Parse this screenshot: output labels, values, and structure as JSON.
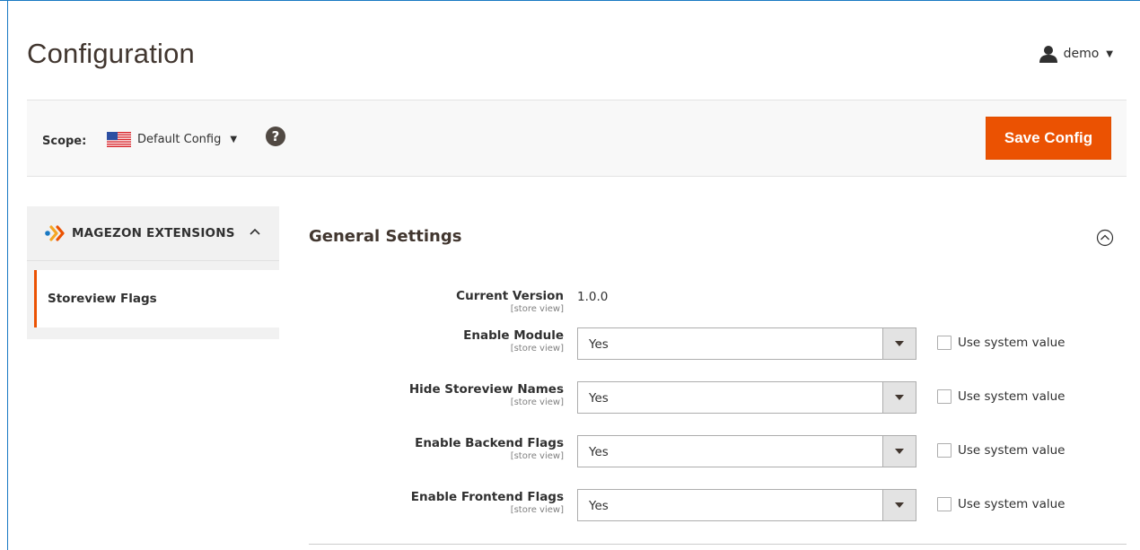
{
  "page": {
    "title": "Configuration"
  },
  "user": {
    "name": "demo",
    "icon": "user-icon"
  },
  "scope": {
    "label": "Scope:",
    "current": "Default Config",
    "flag": "us-flag-icon",
    "help_symbol": "?"
  },
  "actions": {
    "save_label": "Save Config"
  },
  "sidebar": {
    "section": "MAGEZON EXTENSIONS",
    "items": [
      {
        "label": "Storeview Flags",
        "active": true
      }
    ]
  },
  "section": {
    "title": "General Settings"
  },
  "fields": [
    {
      "label": "Current Version",
      "scope": "[store view]",
      "value": "1.0.0"
    },
    {
      "label": "Enable Module",
      "scope": "[store view]",
      "value": "Yes",
      "system_label": "Use system value",
      "use_system": false
    },
    {
      "label": "Hide Storeview Names",
      "scope": "[store view]",
      "value": "Yes",
      "system_label": "Use system value",
      "use_system": false
    },
    {
      "label": "Enable Backend Flags",
      "scope": "[store view]",
      "value": "Yes",
      "system_label": "Use system value",
      "use_system": false
    },
    {
      "label": "Enable Frontend Flags",
      "scope": "[store view]",
      "value": "Yes",
      "system_label": "Use system value",
      "use_system": false
    }
  ],
  "colors": {
    "accent": "#eb5202",
    "frame": "#1979c3",
    "help_bg": "#514943"
  }
}
